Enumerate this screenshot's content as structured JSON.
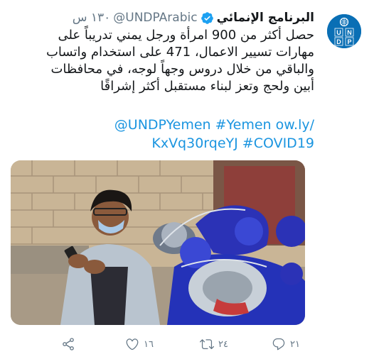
{
  "tweet": {
    "display_name": "البرنامج الإنمائي",
    "handle": "@UNDPArabic",
    "time": "١٣٠ س",
    "avatar_label": "UNDP",
    "body_lines": [
      "حصل  أكثر من 900 امرأة ورجل يمني تدريباً على",
      "مهارات تسيير الاعمال، 471 على استخدام واتساب",
      "والباقي من خلال دروس وجهاً لوجه، في محافظات",
      "أبين ولحج وتعز لبناء مستقبل أكثر إشراقًا"
    ],
    "links_line1": "@UNDPYemen #Yemen ow.ly/",
    "links_line2": "KxVq30rqeYJ #COVID19"
  },
  "actions": {
    "reply_count": "٢١",
    "retweet_count": "٢٤",
    "like_count": "١٦"
  },
  "colors": {
    "link": "#1b95e0",
    "muted": "#657786",
    "verified": "#1da1f2",
    "undp_blue": "#0a6fb5"
  }
}
